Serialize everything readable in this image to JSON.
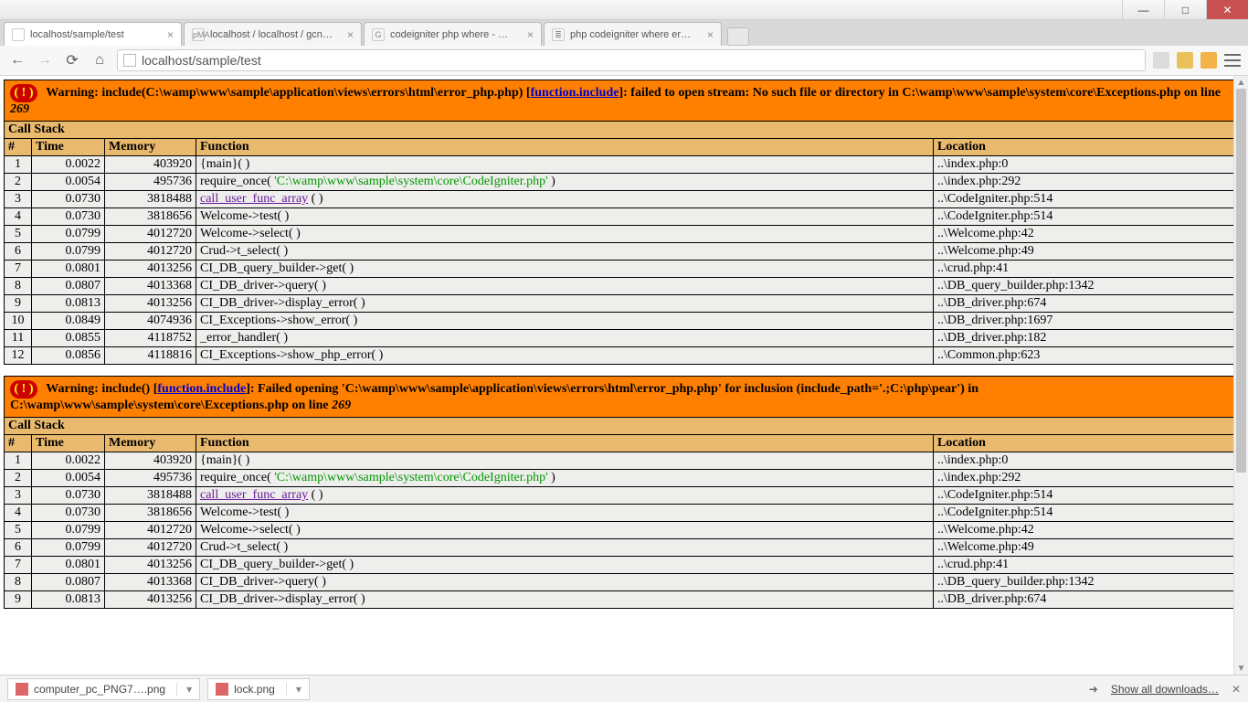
{
  "window": {
    "min": "—",
    "max": "□",
    "close": "✕"
  },
  "tabs": [
    {
      "label": "localhost/sample/test",
      "active": true,
      "fav": ""
    },
    {
      "label": "localhost / localhost / gcn…",
      "active": false,
      "fav": "pMA"
    },
    {
      "label": "codeigniter php where - …",
      "active": false,
      "fav": "G"
    },
    {
      "label": "php codeigniter where er…",
      "active": false,
      "fav": "≣"
    }
  ],
  "nav": {
    "back": "←",
    "fwd": "→",
    "reload": "⟳",
    "home": "⌂"
  },
  "omnibox": {
    "url": "localhost/sample/test"
  },
  "errors": [
    {
      "bang": "( ! )",
      "msg_pre": "Warning: include(C:\\wamp\\www\\sample\\application\\views\\errors\\html\\error_php.php) [",
      "msg_link": "function.include",
      "msg_post": "]: failed to open stream: No such file or directory in C:\\wamp\\www\\sample\\system\\core\\Exceptions.php on line ",
      "msg_line": "269",
      "call_stack": "Call Stack",
      "headers": {
        "num": "#",
        "time": "Time",
        "mem": "Memory",
        "func": "Function",
        "loc": "Location"
      },
      "rows": [
        {
          "n": "1",
          "time": "0.0022",
          "mem": "403920",
          "func_type": "plain",
          "func": "{main}( )",
          "loc": "..\\index.php:0"
        },
        {
          "n": "2",
          "time": "0.0054",
          "mem": "495736",
          "func_type": "require",
          "func_pre": "require_once( ",
          "func_arg": "'C:\\wamp\\www\\sample\\system\\core\\CodeIgniter.php'",
          "func_post": " )",
          "loc": "..\\index.php:292"
        },
        {
          "n": "3",
          "time": "0.0730",
          "mem": "3818488",
          "func_type": "link",
          "func_link": "call_user_func_array",
          "func_post": " ( )",
          "loc": "..\\CodeIgniter.php:514"
        },
        {
          "n": "4",
          "time": "0.0730",
          "mem": "3818656",
          "func_type": "plain",
          "func": "Welcome->test( )",
          "loc": "..\\CodeIgniter.php:514"
        },
        {
          "n": "5",
          "time": "0.0799",
          "mem": "4012720",
          "func_type": "plain",
          "func": "Welcome->select( )",
          "loc": "..\\Welcome.php:42"
        },
        {
          "n": "6",
          "time": "0.0799",
          "mem": "4012720",
          "func_type": "plain",
          "func": "Crud->t_select( )",
          "loc": "..\\Welcome.php:49"
        },
        {
          "n": "7",
          "time": "0.0801",
          "mem": "4013256",
          "func_type": "plain",
          "func": "CI_DB_query_builder->get( )",
          "loc": "..\\crud.php:41"
        },
        {
          "n": "8",
          "time": "0.0807",
          "mem": "4013368",
          "func_type": "plain",
          "func": "CI_DB_driver->query( )",
          "loc": "..\\DB_query_builder.php:1342"
        },
        {
          "n": "9",
          "time": "0.0813",
          "mem": "4013256",
          "func_type": "plain",
          "func": "CI_DB_driver->display_error( )",
          "loc": "..\\DB_driver.php:674"
        },
        {
          "n": "10",
          "time": "0.0849",
          "mem": "4074936",
          "func_type": "plain",
          "func": "CI_Exceptions->show_error( )",
          "loc": "..\\DB_driver.php:1697"
        },
        {
          "n": "11",
          "time": "0.0855",
          "mem": "4118752",
          "func_type": "plain",
          "func": "_error_handler( )",
          "loc": "..\\DB_driver.php:182"
        },
        {
          "n": "12",
          "time": "0.0856",
          "mem": "4118816",
          "func_type": "plain",
          "func": "CI_Exceptions->show_php_error( )",
          "loc": "..\\Common.php:623"
        }
      ]
    },
    {
      "bang": "( ! )",
      "msg_pre": "Warning: include() [",
      "msg_link": "function.include",
      "msg_post": "]: Failed opening 'C:\\wamp\\www\\sample\\application\\views\\errors\\html\\error_php.php' for inclusion (include_path='.;C:\\php\\pear') in C:\\wamp\\www\\sample\\system\\core\\Exceptions.php on line ",
      "msg_line": "269",
      "call_stack": "Call Stack",
      "headers": {
        "num": "#",
        "time": "Time",
        "mem": "Memory",
        "func": "Function",
        "loc": "Location"
      },
      "rows": [
        {
          "n": "1",
          "time": "0.0022",
          "mem": "403920",
          "func_type": "plain",
          "func": "{main}( )",
          "loc": "..\\index.php:0"
        },
        {
          "n": "2",
          "time": "0.0054",
          "mem": "495736",
          "func_type": "require",
          "func_pre": "require_once( ",
          "func_arg": "'C:\\wamp\\www\\sample\\system\\core\\CodeIgniter.php'",
          "func_post": " )",
          "loc": "..\\index.php:292"
        },
        {
          "n": "3",
          "time": "0.0730",
          "mem": "3818488",
          "func_type": "link",
          "func_link": "call_user_func_array",
          "func_post": " ( )",
          "loc": "..\\CodeIgniter.php:514"
        },
        {
          "n": "4",
          "time": "0.0730",
          "mem": "3818656",
          "func_type": "plain",
          "func": "Welcome->test( )",
          "loc": "..\\CodeIgniter.php:514"
        },
        {
          "n": "5",
          "time": "0.0799",
          "mem": "4012720",
          "func_type": "plain",
          "func": "Welcome->select( )",
          "loc": "..\\Welcome.php:42"
        },
        {
          "n": "6",
          "time": "0.0799",
          "mem": "4012720",
          "func_type": "plain",
          "func": "Crud->t_select( )",
          "loc": "..\\Welcome.php:49"
        },
        {
          "n": "7",
          "time": "0.0801",
          "mem": "4013256",
          "func_type": "plain",
          "func": "CI_DB_query_builder->get( )",
          "loc": "..\\crud.php:41"
        },
        {
          "n": "8",
          "time": "0.0807",
          "mem": "4013368",
          "func_type": "plain",
          "func": "CI_DB_driver->query( )",
          "loc": "..\\DB_query_builder.php:1342"
        },
        {
          "n": "9",
          "time": "0.0813",
          "mem": "4013256",
          "func_type": "plain",
          "func": "CI_DB_driver->display_error( )",
          "loc": "..\\DB_driver.php:674"
        }
      ]
    }
  ],
  "downloads": {
    "items": [
      {
        "name": "computer_pc_PNG7….png"
      },
      {
        "name": "lock.png"
      }
    ],
    "show_all": "Show all downloads…",
    "arrow": "➜",
    "close": "✕"
  }
}
